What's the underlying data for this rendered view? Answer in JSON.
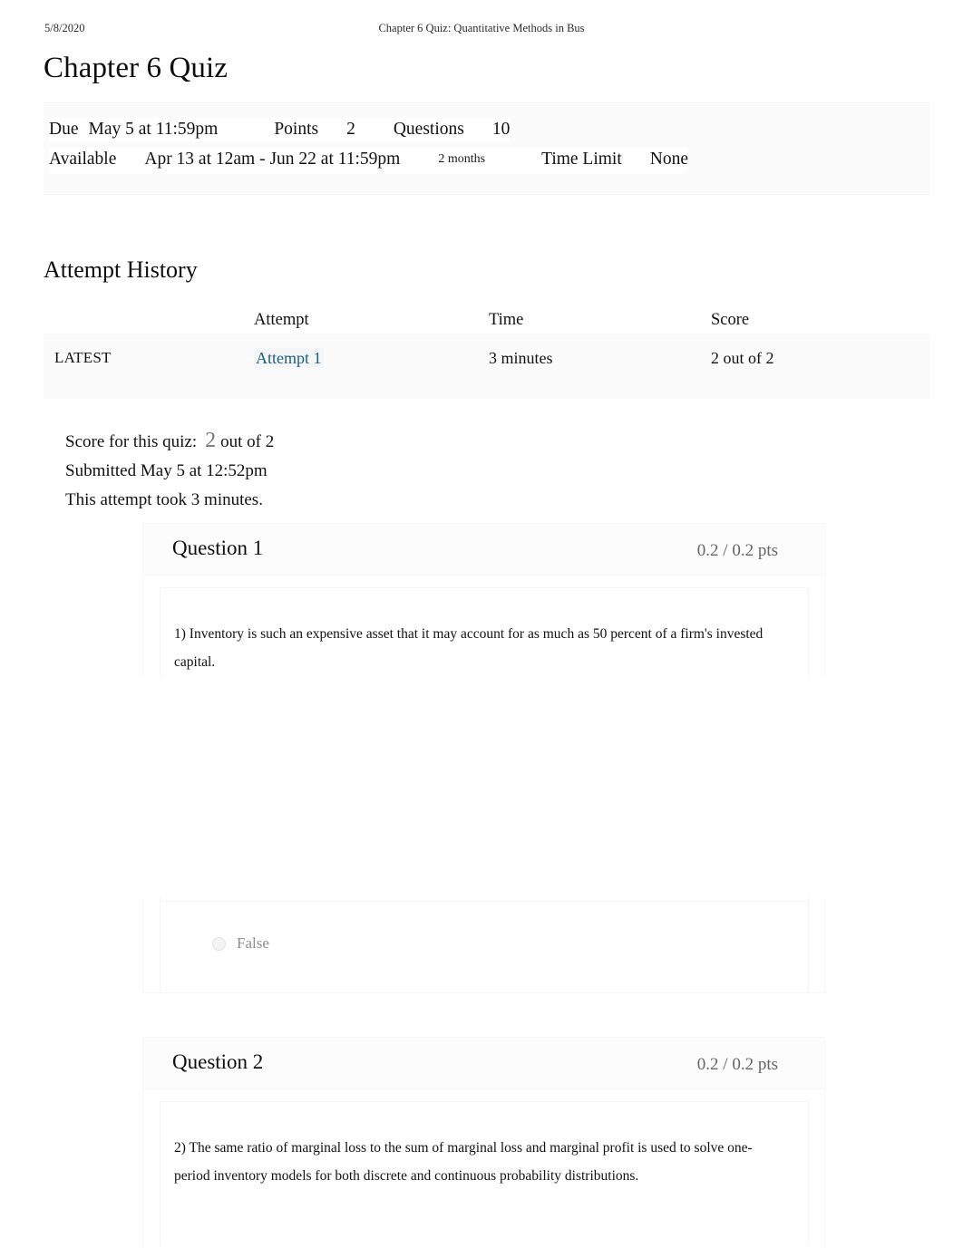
{
  "print_header": {
    "date": "5/8/2020",
    "document_title": "Chapter 6 Quiz: Quantitative Methods in Bus"
  },
  "page_title": "Chapter 6 Quiz",
  "quiz_info": {
    "due_label": "Due",
    "due_value": "May 5 at 11:59pm",
    "points_label": "Points",
    "points_value": "2",
    "questions_label": "Questions",
    "questions_value": "10",
    "available_label": "Available",
    "available_value": "Apr 13 at 12am - Jun 22 at 11:59pm",
    "available_duration": "2 months",
    "time_limit_label": "Time Limit",
    "time_limit_value": "None"
  },
  "attempt_history": {
    "heading": "Attempt History",
    "columns": {
      "kept": "",
      "attempt": "Attempt",
      "time": "Time",
      "score": "Score"
    },
    "rows": [
      {
        "kept": "LATEST",
        "attempt": "Attempt 1",
        "time": "3 minutes",
        "score": "2 out of 2"
      }
    ]
  },
  "score_summary": {
    "score_label": "Score for this quiz:",
    "score_value": "2",
    "score_suffix": "out of 2",
    "submitted": "Submitted May 5 at 12:52pm",
    "duration": "This attempt took 3 minutes."
  },
  "questions": [
    {
      "name": "Question 1",
      "points": "0.2 / 0.2 pts",
      "text": "1) Inventory is such an expensive asset that it may account for as much as 50 percent of a firm's invested capital.",
      "answers": [
        {
          "label": "False",
          "selected": false
        }
      ]
    },
    {
      "name": "Question 2",
      "points": "0.2 / 0.2 pts",
      "text": "2) The same ratio of marginal loss to the sum of marginal loss and marginal profit is used to solve one-period inventory models for both discrete and continuous probability distributions.",
      "answers": []
    }
  ],
  "colors": {
    "link": "#1c5e7e",
    "muted_text": "#8d8d8d",
    "points_text": "#656565",
    "panel_background": "#fbfbfb"
  }
}
